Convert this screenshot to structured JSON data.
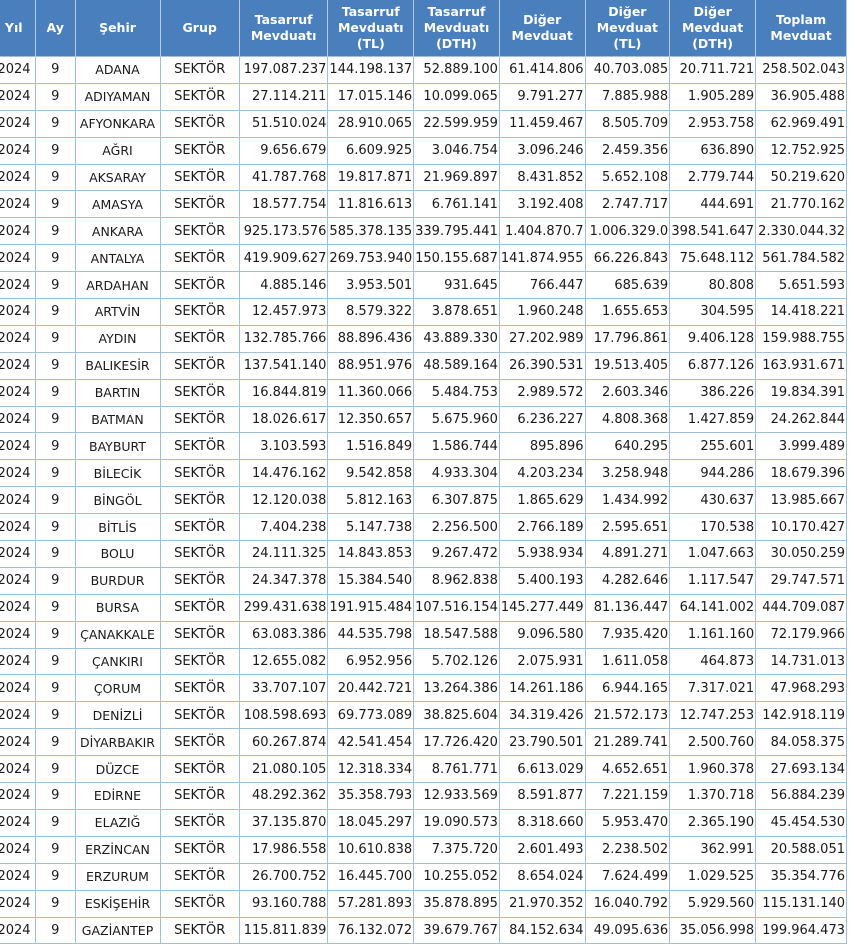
{
  "columns": [
    "Yıl",
    "Ay",
    "Şehir",
    "Grup",
    "Tasarruf Mevduatı",
    "Tasarruf Mevduatı (TL)",
    "Tasarruf Mevduatı (DTH)",
    "Diğer Mevduat",
    "Diğer Mevduat (TL)",
    "Diğer Mevduat (DTH)",
    "Toplam Mevduat"
  ],
  "rows": [
    [
      "2024",
      "9",
      "ADANA",
      "SEKTÖR",
      "197.087.237",
      "144.198.137",
      "52.889.100",
      "61.414.806",
      "40.703.085",
      "20.711.721",
      "258.502.043"
    ],
    [
      "2024",
      "9",
      "ADIYAMAN",
      "SEKTÖR",
      "27.114.211",
      "17.015.146",
      "10.099.065",
      "9.791.277",
      "7.885.988",
      "1.905.289",
      "36.905.488"
    ],
    [
      "2024",
      "9",
      "AFYONKARA",
      "SEKTÖR",
      "51.510.024",
      "28.910.065",
      "22.599.959",
      "11.459.467",
      "8.505.709",
      "2.953.758",
      "62.969.491"
    ],
    [
      "2024",
      "9",
      "AĞRI",
      "SEKTÖR",
      "9.656.679",
      "6.609.925",
      "3.046.754",
      "3.096.246",
      "2.459.356",
      "636.890",
      "12.752.925"
    ],
    [
      "2024",
      "9",
      "AKSARAY",
      "SEKTÖR",
      "41.787.768",
      "19.817.871",
      "21.969.897",
      "8.431.852",
      "5.652.108",
      "2.779.744",
      "50.219.620"
    ],
    [
      "2024",
      "9",
      "AMASYA",
      "SEKTÖR",
      "18.577.754",
      "11.816.613",
      "6.761.141",
      "3.192.408",
      "2.747.717",
      "444.691",
      "21.770.162"
    ],
    [
      "2024",
      "9",
      "ANKARA",
      "SEKTÖR",
      "925.173.576",
      "585.378.135",
      "339.795.441",
      "1.404.870.7",
      "1.006.329.0",
      "398.541.647",
      "2.330.044.32"
    ],
    [
      "2024",
      "9",
      "ANTALYA",
      "SEKTÖR",
      "419.909.627",
      "269.753.940",
      "150.155.687",
      "141.874.955",
      "66.226.843",
      "75.648.112",
      "561.784.582"
    ],
    [
      "2024",
      "9",
      "ARDAHAN",
      "SEKTÖR",
      "4.885.146",
      "3.953.501",
      "931.645",
      "766.447",
      "685.639",
      "80.808",
      "5.651.593"
    ],
    [
      "2024",
      "9",
      "ARTVİN",
      "SEKTÖR",
      "12.457.973",
      "8.579.322",
      "3.878.651",
      "1.960.248",
      "1.655.653",
      "304.595",
      "14.418.221"
    ],
    [
      "2024",
      "9",
      "AYDIN",
      "SEKTÖR",
      "132.785.766",
      "88.896.436",
      "43.889.330",
      "27.202.989",
      "17.796.861",
      "9.406.128",
      "159.988.755"
    ],
    [
      "2024",
      "9",
      "BALIKESİR",
      "SEKTÖR",
      "137.541.140",
      "88.951.976",
      "48.589.164",
      "26.390.531",
      "19.513.405",
      "6.877.126",
      "163.931.671"
    ],
    [
      "2024",
      "9",
      "BARTIN",
      "SEKTÖR",
      "16.844.819",
      "11.360.066",
      "5.484.753",
      "2.989.572",
      "2.603.346",
      "386.226",
      "19.834.391"
    ],
    [
      "2024",
      "9",
      "BATMAN",
      "SEKTÖR",
      "18.026.617",
      "12.350.657",
      "5.675.960",
      "6.236.227",
      "4.808.368",
      "1.427.859",
      "24.262.844"
    ],
    [
      "2024",
      "9",
      "BAYBURT",
      "SEKTÖR",
      "3.103.593",
      "1.516.849",
      "1.586.744",
      "895.896",
      "640.295",
      "255.601",
      "3.999.489"
    ],
    [
      "2024",
      "9",
      "BİLECİK",
      "SEKTÖR",
      "14.476.162",
      "9.542.858",
      "4.933.304",
      "4.203.234",
      "3.258.948",
      "944.286",
      "18.679.396"
    ],
    [
      "2024",
      "9",
      "BİNGÖL",
      "SEKTÖR",
      "12.120.038",
      "5.812.163",
      "6.307.875",
      "1.865.629",
      "1.434.992",
      "430.637",
      "13.985.667"
    ],
    [
      "2024",
      "9",
      "BİTLİS",
      "SEKTÖR",
      "7.404.238",
      "5.147.738",
      "2.256.500",
      "2.766.189",
      "2.595.651",
      "170.538",
      "10.170.427"
    ],
    [
      "2024",
      "9",
      "BOLU",
      "SEKTÖR",
      "24.111.325",
      "14.843.853",
      "9.267.472",
      "5.938.934",
      "4.891.271",
      "1.047.663",
      "30.050.259"
    ],
    [
      "2024",
      "9",
      "BURDUR",
      "SEKTÖR",
      "24.347.378",
      "15.384.540",
      "8.962.838",
      "5.400.193",
      "4.282.646",
      "1.117.547",
      "29.747.571"
    ],
    [
      "2024",
      "9",
      "BURSA",
      "SEKTÖR",
      "299.431.638",
      "191.915.484",
      "107.516.154",
      "145.277.449",
      "81.136.447",
      "64.141.002",
      "444.709.087"
    ],
    [
      "2024",
      "9",
      "ÇANAKKALE",
      "SEKTÖR",
      "63.083.386",
      "44.535.798",
      "18.547.588",
      "9.096.580",
      "7.935.420",
      "1.161.160",
      "72.179.966"
    ],
    [
      "2024",
      "9",
      "ÇANKIRI",
      "SEKTÖR",
      "12.655.082",
      "6.952.956",
      "5.702.126",
      "2.075.931",
      "1.611.058",
      "464.873",
      "14.731.013"
    ],
    [
      "2024",
      "9",
      "ÇORUM",
      "SEKTÖR",
      "33.707.107",
      "20.442.721",
      "13.264.386",
      "14.261.186",
      "6.944.165",
      "7.317.021",
      "47.968.293"
    ],
    [
      "2024",
      "9",
      "DENİZLİ",
      "SEKTÖR",
      "108.598.693",
      "69.773.089",
      "38.825.604",
      "34.319.426",
      "21.572.173",
      "12.747.253",
      "142.918.119"
    ],
    [
      "2024",
      "9",
      "DİYARBAKIR",
      "SEKTÖR",
      "60.267.874",
      "42.541.454",
      "17.726.420",
      "23.790.501",
      "21.289.741",
      "2.500.760",
      "84.058.375"
    ],
    [
      "2024",
      "9",
      "DÜZCE",
      "SEKTÖR",
      "21.080.105",
      "12.318.334",
      "8.761.771",
      "6.613.029",
      "4.652.651",
      "1.960.378",
      "27.693.134"
    ],
    [
      "2024",
      "9",
      "EDİRNE",
      "SEKTÖR",
      "48.292.362",
      "35.358.793",
      "12.933.569",
      "8.591.877",
      "7.221.159",
      "1.370.718",
      "56.884.239"
    ],
    [
      "2024",
      "9",
      "ELAZIĞ",
      "SEKTÖR",
      "37.135.870",
      "18.045.297",
      "19.090.573",
      "8.318.660",
      "5.953.470",
      "2.365.190",
      "45.454.530"
    ],
    [
      "2024",
      "9",
      "ERZİNCAN",
      "SEKTÖR",
      "17.986.558",
      "10.610.838",
      "7.375.720",
      "2.601.493",
      "2.238.502",
      "362.991",
      "20.588.051"
    ],
    [
      "2024",
      "9",
      "ERZURUM",
      "SEKTÖR",
      "26.700.752",
      "16.445.700",
      "10.255.052",
      "8.654.024",
      "7.624.499",
      "1.029.525",
      "35.354.776"
    ],
    [
      "2024",
      "9",
      "ESKİŞEHİR",
      "SEKTÖR",
      "93.160.788",
      "57.281.893",
      "35.878.895",
      "21.970.352",
      "16.040.792",
      "5.929.560",
      "115.131.140"
    ],
    [
      "2024",
      "9",
      "GAZİANTEP",
      "SEKTÖR",
      "115.811.839",
      "76.132.072",
      "39.679.767",
      "84.152.634",
      "49.095.636",
      "35.056.998",
      "199.964.473"
    ]
  ]
}
